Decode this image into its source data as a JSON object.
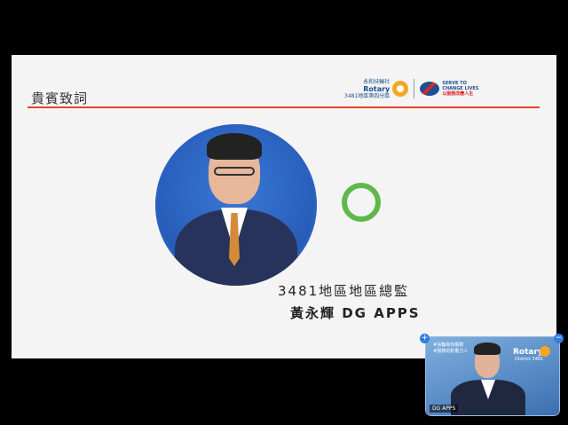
{
  "slide": {
    "title": "貴賓致詞",
    "logo": {
      "club_name": "永和扶輪社",
      "brand": "Rotary",
      "district": "3481地區第四分區",
      "theme_en": "SERVE TO\nCHANGE LIVES",
      "theme_zh": "以服務改變人生"
    },
    "caption_line1": "3481地區地區總監",
    "caption_line2": "黃永輝 DG APPS",
    "colors": {
      "rule": "#e2452a",
      "ring": "#5fb84a",
      "portrait_bg": "#2b62c0"
    }
  },
  "video": {
    "topleft_text": "#扶輪為你服務\n#服務的影響力人",
    "brand": "Rotary",
    "brand_sub": "District 3481",
    "name_tag": "DG APPS",
    "controls": {
      "expand": "+",
      "collapse": "−"
    }
  }
}
